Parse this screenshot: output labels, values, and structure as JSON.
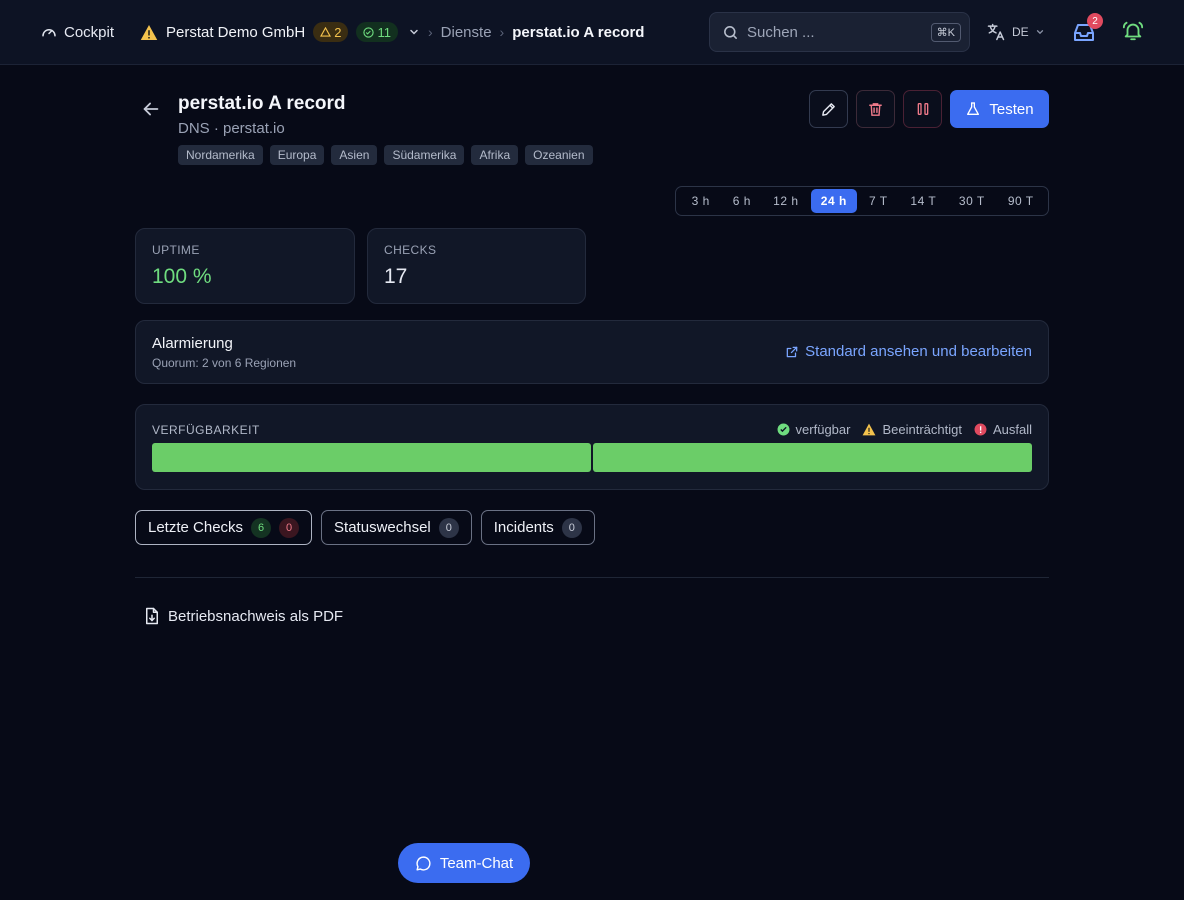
{
  "topbar": {
    "cockpit_label": "Cockpit",
    "org_name": "Perstat Demo GmbH",
    "warn_count": "2",
    "ok_count": "11",
    "breadcrumb_parent": "Dienste",
    "breadcrumb_current": "perstat.io A record",
    "search_placeholder": "Suchen ...",
    "search_shortcut": "⌘K",
    "language": "DE",
    "inbox_badge": "2"
  },
  "header": {
    "title": "perstat.io A record",
    "subtitle": "DNS · perstat.io",
    "tags": [
      "Nordamerika",
      "Europa",
      "Asien",
      "Südamerika",
      "Afrika",
      "Ozeanien"
    ],
    "test_button": "Testen"
  },
  "ranges": {
    "items": [
      "3 h",
      "6 h",
      "12 h",
      "24 h",
      "7 T",
      "14 T",
      "30 T",
      "90 T"
    ],
    "active": "24 h"
  },
  "stats": {
    "uptime_label": "UPTIME",
    "uptime_value": "100 %",
    "checks_label": "CHECKS",
    "checks_value": "17"
  },
  "alarm": {
    "title": "Alarmierung",
    "subtitle": "Quorum: 2 von 6 Regionen",
    "link": "Standard ansehen und bearbeiten"
  },
  "availability": {
    "label": "VERFÜGBARKEIT",
    "legend_ok": "verfügbar",
    "legend_warn": "Beeinträchtigt",
    "legend_down": "Ausfall",
    "segments": [
      "verfügbar",
      "verfügbar"
    ],
    "color_ok": "#6bcd68"
  },
  "tabs": {
    "last_checks": "Letzte Checks",
    "last_checks_ok": "6",
    "last_checks_fail": "0",
    "status_changes": "Statuswechsel",
    "status_changes_count": "0",
    "incidents": "Incidents",
    "incidents_count": "0"
  },
  "pdf_label": "Betriebsnachweis als PDF",
  "chat_label": "Team-Chat",
  "colors": {
    "accent": "#3b6cf0",
    "ok": "#6fdc7f",
    "warn": "#f3c24d",
    "danger": "#e04a5f"
  }
}
